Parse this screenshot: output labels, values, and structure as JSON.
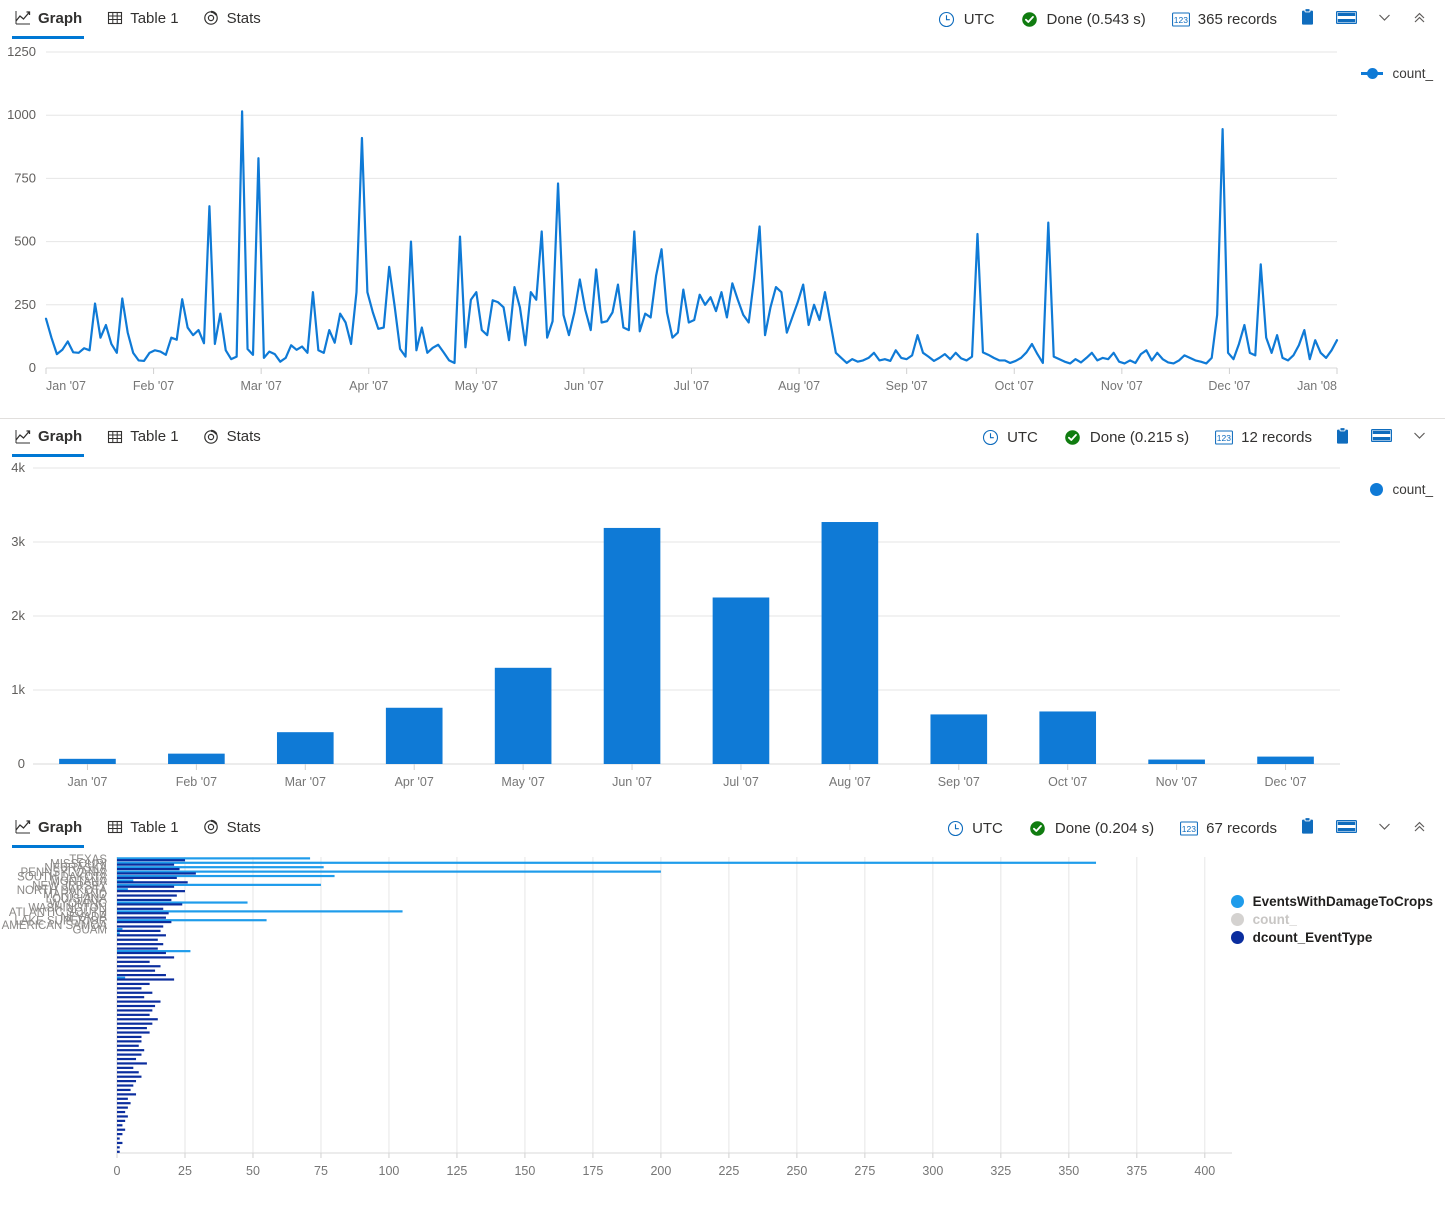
{
  "panels": [
    {
      "tabs": [
        {
          "label": "Graph",
          "icon": "line-chart-icon",
          "active": true
        },
        {
          "label": "Table 1",
          "icon": "table-icon",
          "active": false
        },
        {
          "label": "Stats",
          "icon": "donut-icon",
          "active": false
        }
      ],
      "status": {
        "timezone": "UTC",
        "state": "Done (0.543 s)",
        "records": "365 records",
        "clock_icon": "clock-icon",
        "check_icon": "check-circle-icon",
        "records_icon": "numbers-123-icon",
        "copy_icon": "clipboard-icon",
        "layout_icon": "panel-layout-icon",
        "chevron_icon": "chevron-down-icon",
        "collapse_icon": "double-chevron-up-icon"
      },
      "legend": [
        {
          "label": "count_",
          "color": "#0f7ad6",
          "style": "line"
        }
      ]
    },
    {
      "tabs": [
        {
          "label": "Graph",
          "icon": "line-chart-icon",
          "active": true
        },
        {
          "label": "Table 1",
          "icon": "table-icon",
          "active": false
        },
        {
          "label": "Stats",
          "icon": "donut-icon",
          "active": false
        }
      ],
      "status": {
        "timezone": "UTC",
        "state": "Done (0.215 s)",
        "records": "12 records",
        "clock_icon": "clock-icon",
        "check_icon": "check-circle-icon",
        "records_icon": "numbers-123-icon",
        "copy_icon": "clipboard-icon",
        "layout_icon": "panel-layout-icon",
        "chevron_icon": "chevron-down-icon",
        "collapse_icon": ""
      },
      "legend": [
        {
          "label": "count_",
          "color": "#0f7ad6",
          "style": "dot"
        }
      ]
    },
    {
      "tabs": [
        {
          "label": "Graph",
          "icon": "line-chart-icon",
          "active": true
        },
        {
          "label": "Table 1",
          "icon": "table-icon",
          "active": false
        },
        {
          "label": "Stats",
          "icon": "donut-icon",
          "active": false
        }
      ],
      "status": {
        "timezone": "UTC",
        "state": "Done (0.204 s)",
        "records": "67 records",
        "clock_icon": "clock-icon",
        "check_icon": "check-circle-icon",
        "records_icon": "numbers-123-icon",
        "copy_icon": "clipboard-icon",
        "layout_icon": "panel-layout-icon",
        "chevron_icon": "chevron-down-icon",
        "collapse_icon": "double-chevron-up-icon"
      },
      "legend": [
        {
          "label": "EventsWithDamageToCrops",
          "color": "#1f9ceb",
          "style": "dot"
        },
        {
          "label": "count_",
          "color": "#d4d2d0",
          "style": "dot",
          "muted": true
        },
        {
          "label": "dcount_EventType",
          "color": "#0b2d9e",
          "style": "dot"
        }
      ]
    }
  ],
  "chart_data": [
    {
      "type": "line",
      "title": "",
      "xlabel": "",
      "ylabel": "",
      "ylim": [
        0,
        1250
      ],
      "yticks": [
        0,
        250,
        500,
        750,
        1000,
        1250
      ],
      "xticks": [
        "Jan '07",
        "Feb '07",
        "Mar '07",
        "Apr '07",
        "May '07",
        "Jun '07",
        "Jul '07",
        "Aug '07",
        "Sep '07",
        "Oct '07",
        "Nov '07",
        "Dec '07",
        "Jan '08"
      ],
      "grid": true,
      "legend_position": "right",
      "series": [
        {
          "name": "count_",
          "color": "#0f7ad6",
          "values": [
            195,
            120,
            55,
            72,
            105,
            62,
            60,
            78,
            70,
            255,
            120,
            170,
            95,
            60,
            275,
            140,
            60,
            30,
            28,
            60,
            70,
            65,
            52,
            120,
            112,
            272,
            160,
            130,
            150,
            98,
            640,
            95,
            215,
            70,
            35,
            45,
            1015,
            75,
            52,
            830,
            40,
            65,
            55,
            25,
            40,
            90,
            72,
            85,
            60,
            300,
            70,
            60,
            150,
            100,
            215,
            180,
            95,
            300,
            910,
            300,
            220,
            155,
            160,
            400,
            245,
            75,
            45,
            500,
            70,
            160,
            60,
            80,
            92,
            62,
            30,
            20,
            520,
            82,
            270,
            300,
            150,
            130,
            268,
            260,
            240,
            110,
            320,
            240,
            90,
            300,
            270,
            540,
            120,
            185,
            730,
            210,
            130,
            220,
            350,
            230,
            150,
            390,
            180,
            185,
            220,
            330,
            160,
            150,
            540,
            145,
            215,
            200,
            365,
            470,
            220,
            120,
            140,
            310,
            180,
            190,
            290,
            250,
            280,
            225,
            300,
            200,
            335,
            270,
            210,
            180,
            355,
            560,
            130,
            240,
            320,
            300,
            140,
            200,
            260,
            330,
            170,
            250,
            190,
            300,
            180,
            60,
            40,
            20,
            35,
            25,
            30,
            40,
            60,
            30,
            35,
            28,
            70,
            40,
            35,
            50,
            130,
            60,
            45,
            28,
            40,
            55,
            35,
            60,
            38,
            30,
            45,
            530,
            62,
            52,
            40,
            30,
            30,
            20,
            28,
            40,
            62,
            95,
            55,
            20,
            575,
            45,
            35,
            25,
            18,
            35,
            22,
            40,
            60,
            30,
            40,
            35,
            60,
            25,
            18,
            30,
            20,
            55,
            70,
            30,
            60,
            35,
            22,
            18,
            30,
            50,
            40,
            30,
            25,
            18,
            40,
            210,
            945,
            60,
            35,
            95,
            170,
            60,
            50,
            410,
            120,
            60,
            130,
            40,
            30,
            50,
            90,
            150,
            35,
            110,
            60,
            40,
            70,
            110
          ]
        }
      ]
    },
    {
      "type": "bar",
      "title": "",
      "xlabel": "",
      "ylabel": "",
      "ylim": [
        0,
        4000
      ],
      "yticks": [
        0,
        1000,
        2000,
        3000,
        4000
      ],
      "ytick_labels": [
        "0",
        "1k",
        "2k",
        "3k",
        "4k"
      ],
      "categories": [
        "Jan '07",
        "Feb '07",
        "Mar '07",
        "Apr '07",
        "May '07",
        "Jun '07",
        "Jul '07",
        "Aug '07",
        "Sep '07",
        "Oct '07",
        "Nov '07",
        "Dec '07"
      ],
      "grid": true,
      "legend_position": "right",
      "series": [
        {
          "name": "count_",
          "color": "#0f7ad6",
          "values": [
            70,
            140,
            430,
            760,
            1300,
            3190,
            2250,
            3270,
            670,
            710,
            60,
            100
          ]
        }
      ]
    },
    {
      "type": "bar",
      "orientation": "horizontal",
      "title": "",
      "xlabel": "",
      "ylabel": "",
      "xlim": [
        0,
        410
      ],
      "xticks": [
        0,
        25,
        50,
        75,
        100,
        125,
        150,
        175,
        200,
        225,
        250,
        275,
        300,
        325,
        350,
        375,
        400
      ],
      "grid": true,
      "legend_position": "right",
      "visible_categories": [
        "TEXAS",
        "MISSOURI",
        "NEBRASKA",
        "PENNSYLVANIA",
        "SOUTH DAKOTA",
        "MONTANA",
        "NEW JERSEY",
        "NORTH DAKOTA",
        "MARYLAND",
        "LOUISIANA",
        "WYOMING",
        "WASHINGTON",
        "ATLANTIC SOUTH",
        "NEVADA",
        "LAKE SUPERIOR",
        "AMERICAN SAMOA",
        "GUAM"
      ],
      "series": [
        {
          "name": "EventsWithDamageToCrops",
          "color": "#1f9ceb",
          "values": [
            71,
            360,
            76,
            200,
            80,
            6,
            75,
            4,
            0,
            0,
            48,
            0,
            105,
            0,
            55,
            0,
            2,
            1,
            0,
            0,
            0,
            27,
            0,
            0,
            0,
            0,
            0,
            3,
            0,
            0,
            0,
            0,
            0,
            0,
            0,
            0,
            0,
            0,
            0,
            0,
            0,
            0,
            0,
            0,
            0,
            0,
            0,
            0,
            0,
            0,
            0,
            0,
            0,
            0,
            0,
            0,
            0,
            0,
            0,
            0,
            0,
            0,
            0,
            0,
            0,
            0,
            0
          ]
        },
        {
          "name": "dcount_EventType",
          "color": "#0b2d9e",
          "values": [
            25,
            21,
            23,
            29,
            22,
            26,
            21,
            25,
            22,
            20,
            24,
            17,
            19,
            18,
            20,
            17,
            16,
            18,
            15,
            17,
            15,
            18,
            21,
            12,
            16,
            14,
            18,
            21,
            12,
            9,
            13,
            10,
            16,
            14,
            13,
            12,
            15,
            13,
            11,
            12,
            9,
            9,
            8,
            10,
            9,
            7,
            11,
            6,
            8,
            9,
            7,
            6,
            5,
            7,
            4,
            5,
            4,
            3,
            4,
            3,
            2,
            3,
            2,
            1,
            2,
            1,
            1
          ]
        }
      ]
    }
  ]
}
